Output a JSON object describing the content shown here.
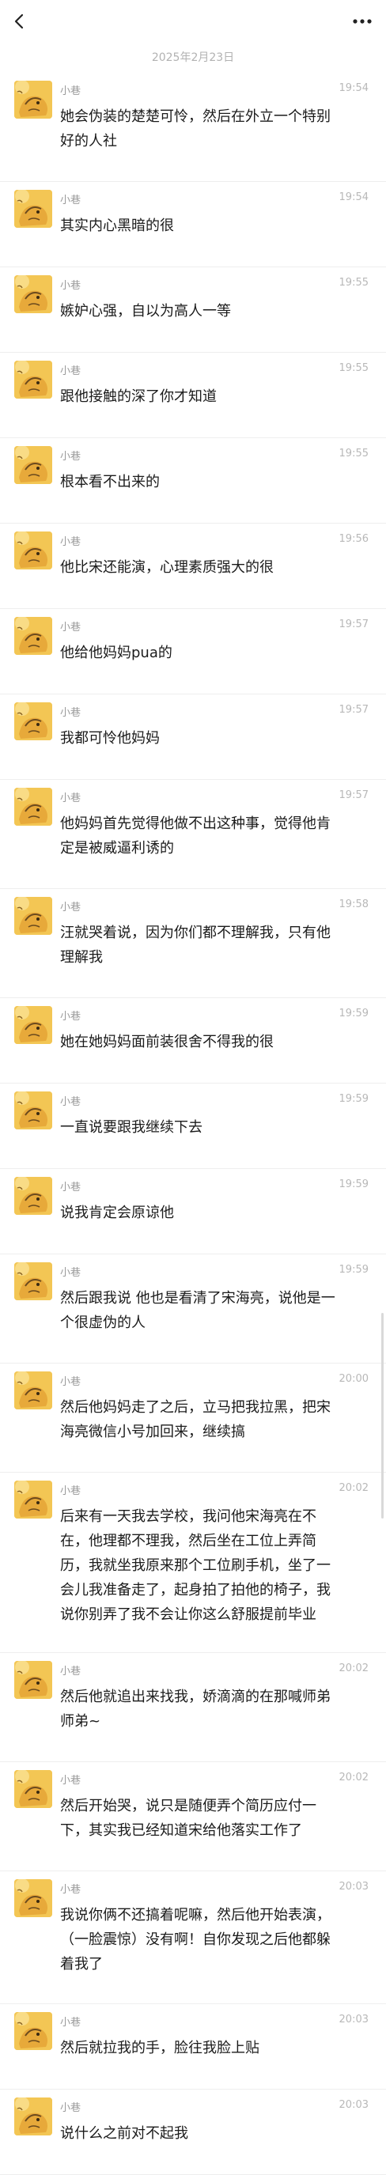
{
  "header": {
    "back_icon": "chevron-left-icon",
    "more_icon": "more-dots-icon"
  },
  "date_separator": "2025年2月23日",
  "messages": [
    {
      "sender": "小巷",
      "time": "19:54",
      "text": "她会伪装的楚楚可怜，然后在外立一个特别\n好的人社"
    },
    {
      "sender": "小巷",
      "time": "19:54",
      "text": "其实内心黑暗的很"
    },
    {
      "sender": "小巷",
      "time": "19:55",
      "text": "嫉妒心强，自以为高人一等"
    },
    {
      "sender": "小巷",
      "time": "19:55",
      "text": "跟他接触的深了你才知道"
    },
    {
      "sender": "小巷",
      "time": "19:55",
      "text": "根本看不出来的"
    },
    {
      "sender": "小巷",
      "time": "19:56",
      "text": "他比宋还能演，心理素质强大的很"
    },
    {
      "sender": "小巷",
      "time": "19:57",
      "text": "他给他妈妈pua的"
    },
    {
      "sender": "小巷",
      "time": "19:57",
      "text": "我都可怜他妈妈"
    },
    {
      "sender": "小巷",
      "time": "19:57",
      "text": "他妈妈首先觉得他做不出这种事，觉得他肯\n定是被威逼利诱的"
    },
    {
      "sender": "小巷",
      "time": "19:58",
      "text": "汪就哭着说，因为你们都不理解我，只有他\n理解我"
    },
    {
      "sender": "小巷",
      "time": "19:59",
      "text": "她在她妈妈面前装很舍不得我的很"
    },
    {
      "sender": "小巷",
      "time": "19:59",
      "text": "一直说要跟我继续下去"
    },
    {
      "sender": "小巷",
      "time": "19:59",
      "text": "说我肯定会原谅他"
    },
    {
      "sender": "小巷",
      "time": "19:59",
      "text": "然后跟我说 他也是看清了宋海亮，说他是一\n个很虚伪的人"
    },
    {
      "sender": "小巷",
      "time": "20:00",
      "text": "然后他妈妈走了之后，立马把我拉黑，把宋\n海亮微信小号加回来，继续搞"
    },
    {
      "sender": "小巷",
      "time": "20:02",
      "text": "后来有一天我去学校，我问他宋海亮在不\n在，他理都不理我，然后坐在工位上弄简\n历，我就坐我原来那个工位刷手机，坐了一\n会儿我准备走了，起身拍了拍他的椅子，我\n说你别弄了我不会让你这么舒服提前毕业"
    },
    {
      "sender": "小巷",
      "time": "20:02",
      "text": "然后他就追出来找我，娇滴滴的在那喊师弟\n师弟~"
    },
    {
      "sender": "小巷",
      "time": "20:02",
      "text": "然后开始哭，说只是随便弄个简历应付一\n下，其实我已经知道宋给他落实工作了"
    },
    {
      "sender": "小巷",
      "time": "20:03",
      "text": "我说你俩不还搞着呢嘛，然后他开始表演，\n（一脸震惊）没有啊！自你发现之后他都躲\n着我了"
    },
    {
      "sender": "小巷",
      "time": "20:03",
      "text": "然后就拉我的手，脸往我脸上贴"
    },
    {
      "sender": "小巷",
      "time": "20:03",
      "text": "说什么之前对不起我"
    }
  ]
}
